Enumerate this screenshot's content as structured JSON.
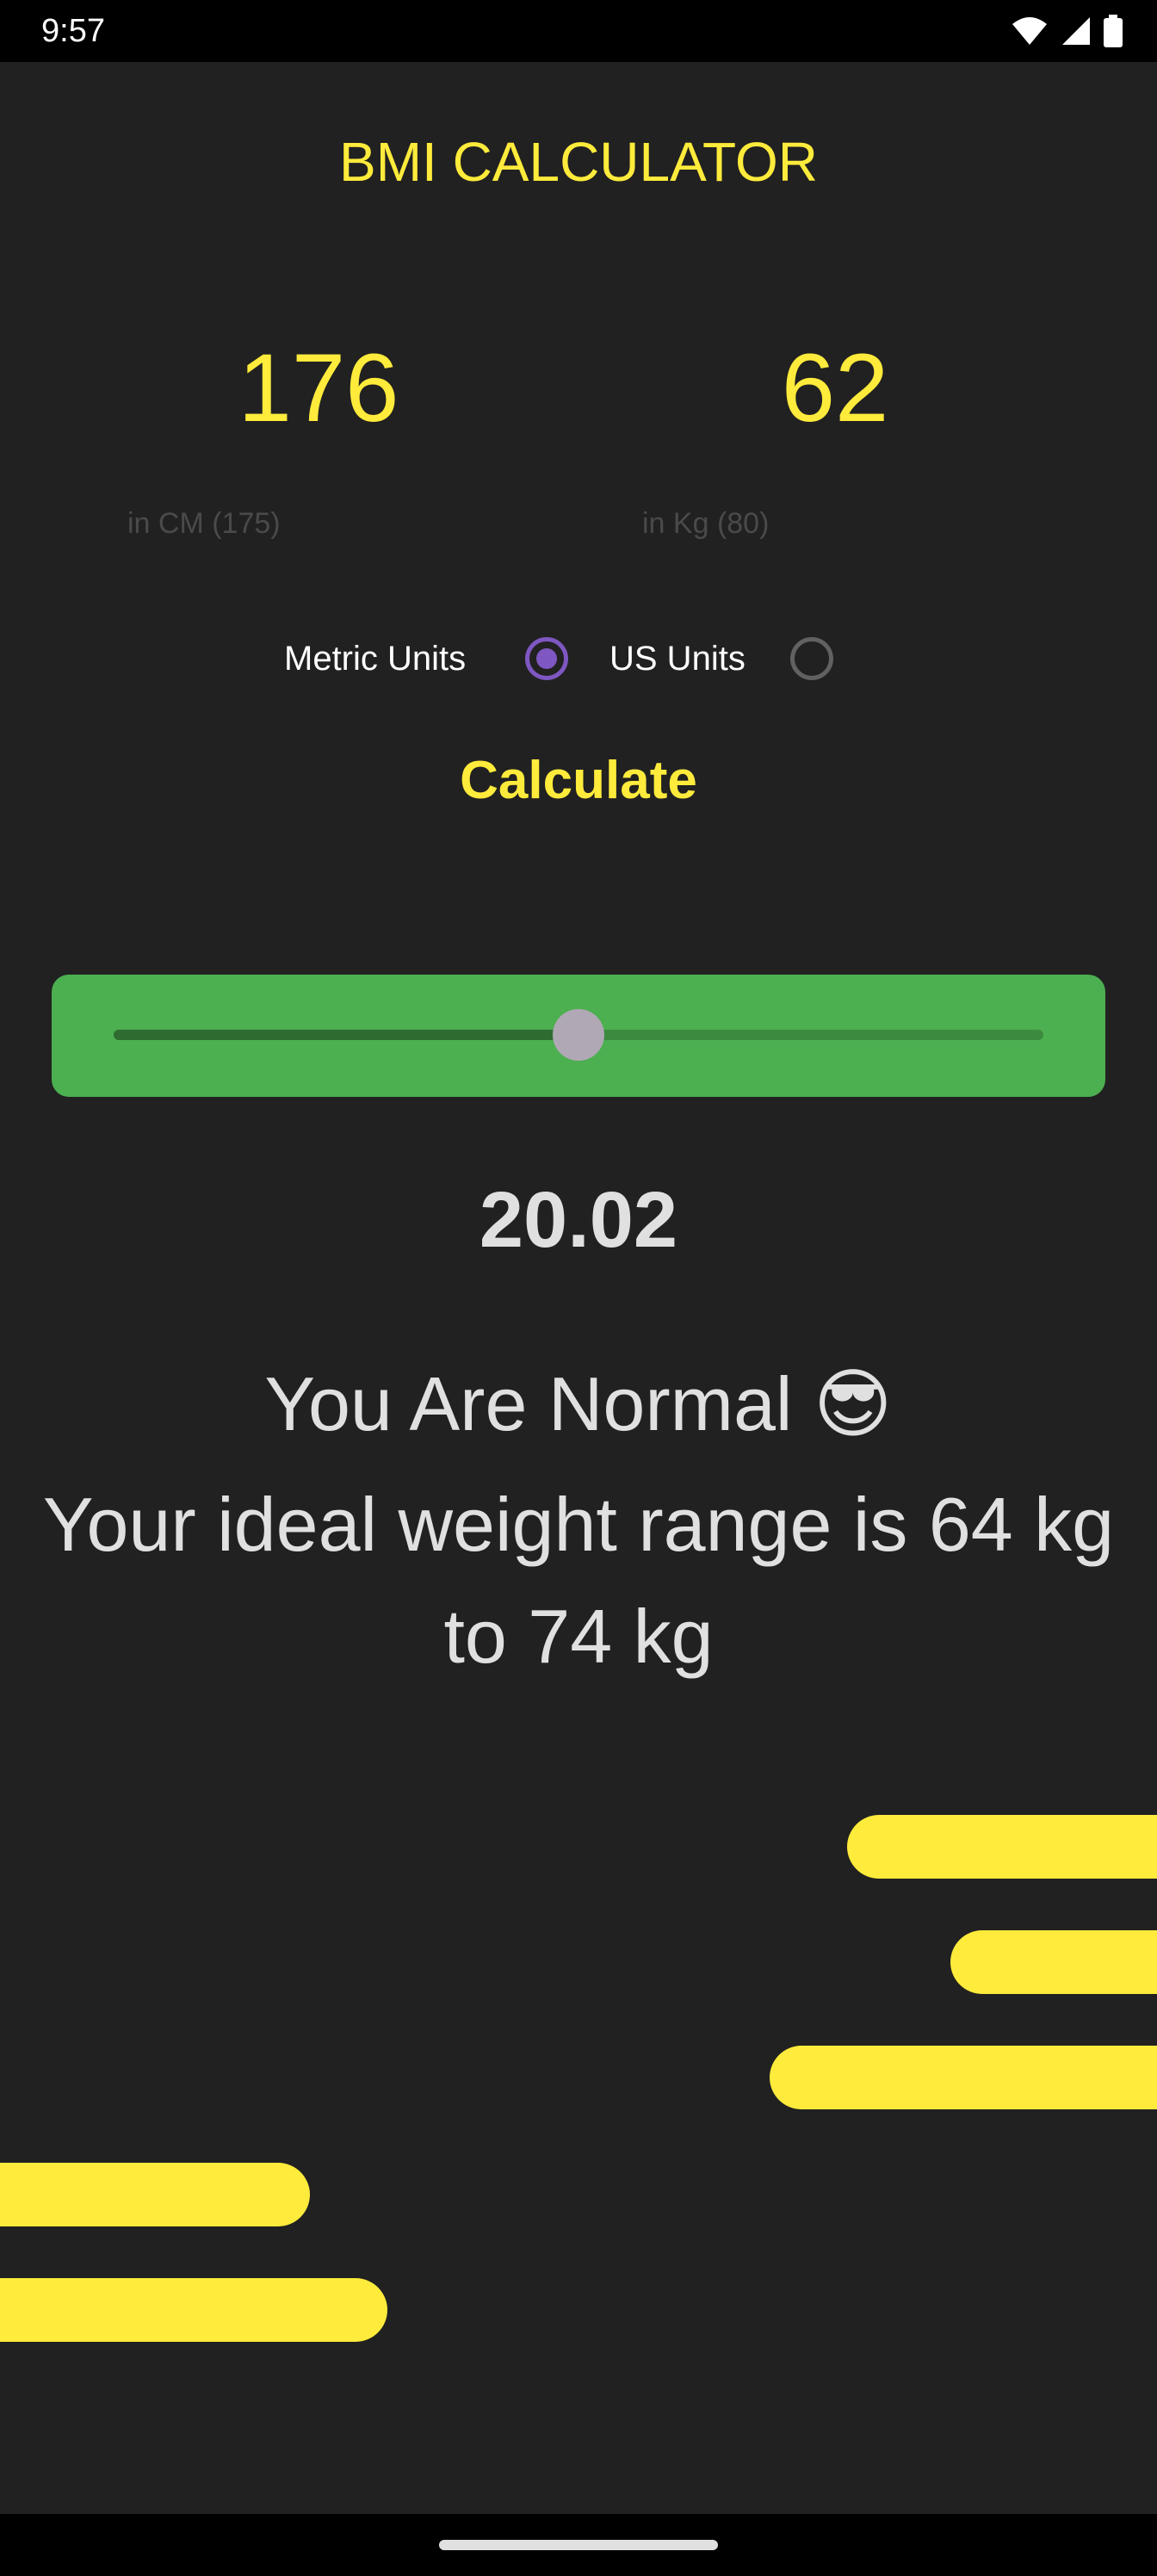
{
  "status_bar": {
    "time": "9:57",
    "icons": [
      "wifi-icon",
      "signal-icon",
      "battery-icon"
    ]
  },
  "app": {
    "title": "BMI CALCULATOR",
    "accent_color": "#ffeb3b",
    "background_color": "#212121"
  },
  "inputs": {
    "height": {
      "value": "176",
      "hint": "in CM (175)"
    },
    "weight": {
      "value": "62",
      "hint": "in Kg (80)"
    }
  },
  "units": {
    "metric_label": "Metric Units",
    "us_label": "US Units",
    "selected": "metric"
  },
  "calculate_label": "Calculate",
  "result": {
    "card_color": "#4caf50",
    "slider_fraction": 0.5,
    "bmi": "20.02",
    "status": "You Are Normal 😎",
    "ideal_range": "Your ideal weight range is 64 kg to 74 kg"
  },
  "decorations": {
    "bar_color": "#ffeb3b"
  }
}
